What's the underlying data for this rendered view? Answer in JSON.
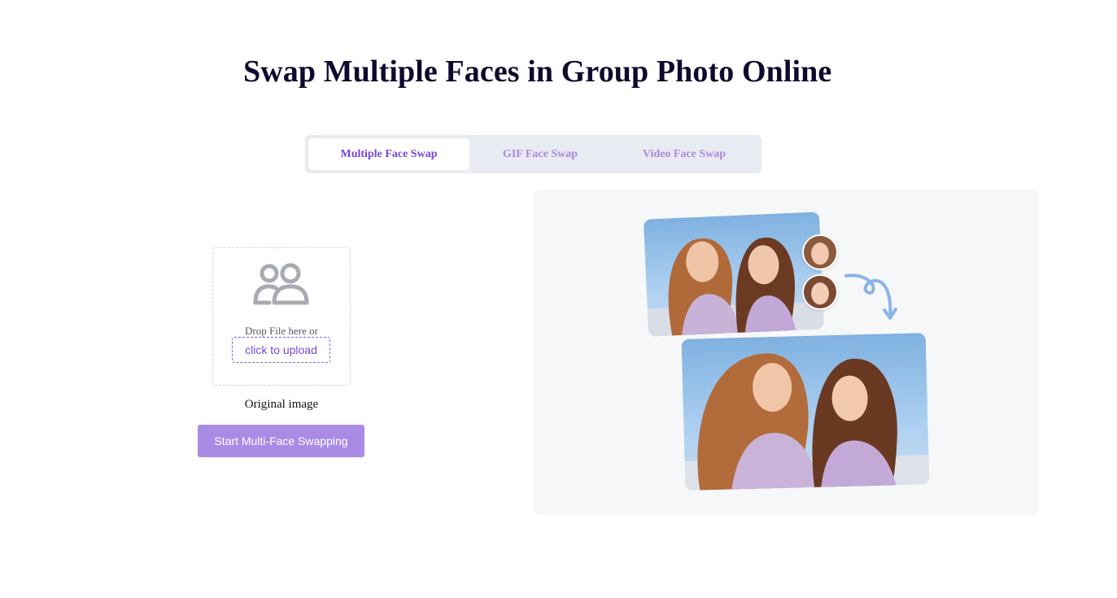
{
  "page": {
    "title": "Swap Multiple Faces in Group Photo Online"
  },
  "tabs": [
    {
      "label": "Multiple Face Swap",
      "active": true
    },
    {
      "label": "GIF Face Swap",
      "active": false
    },
    {
      "label": "Video Face Swap",
      "active": false
    }
  ],
  "upload": {
    "icon": "people-icon",
    "drop_text": "Drop File here or",
    "link_label": "click to upload",
    "caption": "Original image"
  },
  "actions": {
    "start_label": "Start Multi-Face Swapping"
  },
  "colors": {
    "accent": "#7646d6",
    "button": "#a98be6",
    "tab_inactive": "#a98be0",
    "title": "#0d0a2e",
    "panel": "#f6f7f9",
    "arrow": "#8ab4e8"
  }
}
